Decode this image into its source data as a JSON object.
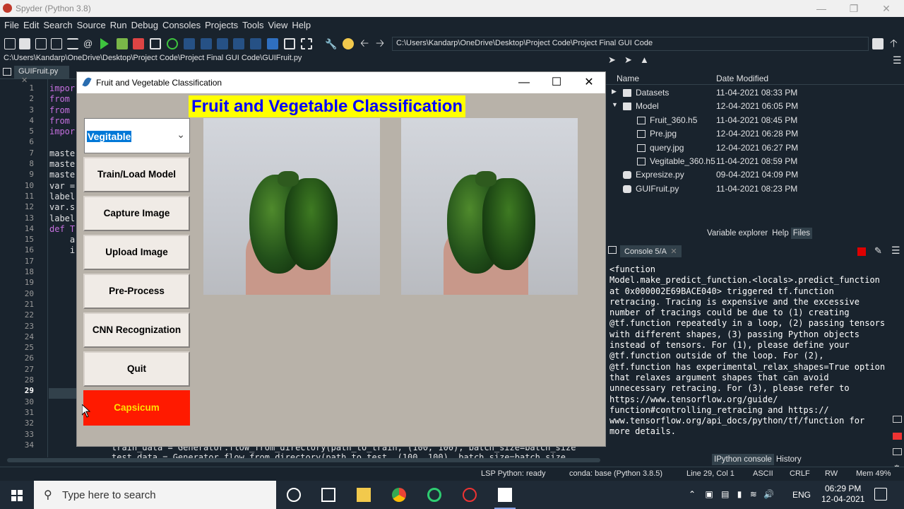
{
  "window": {
    "title": "Spyder (Python 3.8)"
  },
  "menu": [
    "File",
    "Edit",
    "Search",
    "Source",
    "Run",
    "Debug",
    "Consoles",
    "Projects",
    "Tools",
    "View",
    "Help"
  ],
  "toolbar": {
    "path": "C:\\Users\\Kandarp\\OneDrive\\Desktop\\Project Code\\Project Final GUI Code"
  },
  "editor": {
    "filepath": "C:\\Users\\Kandarp\\OneDrive\\Desktop\\Project Code\\Project Final GUI Code\\GUIFruit.py",
    "tab": "GUIFruit.py",
    "line_numbers": [
      "1",
      "2",
      "3",
      "4",
      "5",
      "6",
      "7",
      "8",
      "9",
      "10",
      "11",
      "12",
      "13",
      "14",
      "15",
      "16",
      "17",
      "18",
      "19",
      "20",
      "21",
      "22",
      "23",
      "24",
      "25",
      "26",
      "27",
      "28",
      "29",
      "30",
      "31",
      "32",
      "33",
      "34"
    ],
    "current_line": "29",
    "code": [
      "impor",
      "from",
      "from",
      "from",
      "impor",
      "",
      "maste",
      "maste",
      "maste",
      "var =",
      "label",
      "var.s",
      "label",
      "def T",
      "    a",
      "    i"
    ],
    "bottom_line_1": "train_data = Generator.flow_from_directory(path_to_train, (100, 100), batch_size=batch_size",
    "bottom_line_2": "test_data = Generator.flow_from_directory(path_to_test, (100, 100), batch_size=batch_size"
  },
  "app": {
    "title": "Fruit and Vegetable Classification",
    "heading": "Fruit and Vegetable Classification",
    "dropdown_value": "Vegitable",
    "buttons": {
      "train": "Train/Load Model",
      "capture": "Capture Image",
      "upload": "Upload Image",
      "preprocess": "Pre-Process",
      "cnn": "CNN Recognization",
      "quit": "Quit"
    },
    "result": "Capsicum",
    "colors": {
      "heading_bg": "#ffff00",
      "heading_fg": "#0000ff",
      "result_bg": "#ff1a00",
      "result_fg": "#ffe000"
    }
  },
  "files": {
    "headers": {
      "name": "Name",
      "date": "Date Modified"
    },
    "rows": [
      {
        "name": "Datasets",
        "date": "11-04-2021 08:33 PM",
        "icon": "folder-icon",
        "indent": 0
      },
      {
        "name": "Model",
        "date": "12-04-2021 06:05 PM",
        "icon": "folder-icon",
        "indent": 0
      },
      {
        "name": "Fruit_360.h5",
        "date": "11-04-2021 08:45 PM",
        "icon": "file-icon",
        "indent": 1
      },
      {
        "name": "Pre.jpg",
        "date": "12-04-2021 06:28 PM",
        "icon": "image-icon",
        "indent": 1
      },
      {
        "name": "query.jpg",
        "date": "12-04-2021 06:27 PM",
        "icon": "image-icon",
        "indent": 1
      },
      {
        "name": "Vegitable_360.h5",
        "date": "11-04-2021 08:59 PM",
        "icon": "file-icon",
        "indent": 1
      },
      {
        "name": "Expresize.py",
        "date": "09-04-2021 04:09 PM",
        "icon": "python-icon",
        "indent": 0
      },
      {
        "name": "GUIFruit.py",
        "date": "11-04-2021 08:23 PM",
        "icon": "python-icon",
        "indent": 0
      }
    ],
    "pane_tabs": [
      "Variable explorer",
      "Help",
      "Files"
    ]
  },
  "console": {
    "tab": "Console 5/A",
    "text": "<function\nModel.make_predict_function.<locals>.predict_function\nat 0x000002E69BACE040> triggered tf.function\nretracing. Tracing is expensive and the excessive\nnumber of tracings could be due to (1) creating\n@tf.function repeatedly in a loop, (2) passing tensors\nwith different shapes, (3) passing Python objects\ninstead of tensors. For (1), please define your\n@tf.function outside of the loop. For (2),\n@tf.function has experimental_relax_shapes=True option\nthat relaxes argument shapes that can avoid\nunnecessary retracing. For (3), please refer to\nhttps://www.tensorflow.org/guide/\nfunction#controlling_retracing and https://\nwww.tensorflow.org/api_docs/python/tf/function for\nmore details.",
    "tabs": [
      "IPython console",
      "History"
    ]
  },
  "status": {
    "lsp": "LSP Python: ready",
    "conda": "conda: base (Python 3.8.5)",
    "pos": "Line 29, Col 1",
    "enc": "ASCII",
    "eol": "CRLF",
    "rw": "RW",
    "mem": "Mem 49%"
  },
  "taskbar": {
    "search_placeholder": "Type here to search",
    "lang": "ENG",
    "time": "06:29 PM",
    "date": "12-04-2021"
  }
}
